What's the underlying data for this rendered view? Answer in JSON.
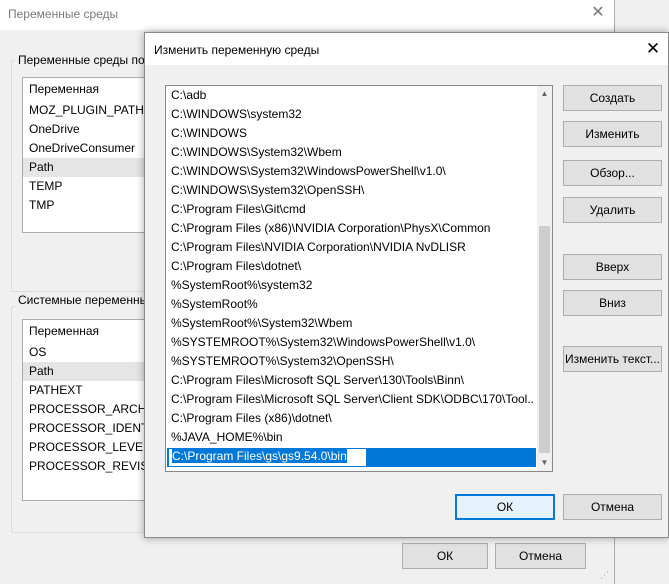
{
  "background_dialog": {
    "title": "Переменные среды",
    "user_group_label": "Переменные среды по",
    "user_list": {
      "header": "Переменная",
      "rows": [
        "MOZ_PLUGIN_PATH",
        "OneDrive",
        "OneDriveConsumer",
        "Path",
        "TEMP",
        "TMP"
      ]
    },
    "system_group_label": "Системные переменные",
    "system_list": {
      "header": "Переменная",
      "rows": [
        "OS",
        "Path",
        "PATHEXT",
        "PROCESSOR_ARCHITE",
        "PROCESSOR_IDENTIFI",
        "PROCESSOR_LEVEL",
        "PROCESSOR_REVISION"
      ]
    },
    "ok_label": "ОК",
    "cancel_label": "Отмена"
  },
  "edit_dialog": {
    "title": "Изменить переменную среды",
    "paths": [
      "C:\\adb",
      "C:\\WINDOWS\\system32",
      "C:\\WINDOWS",
      "C:\\WINDOWS\\System32\\Wbem",
      "C:\\WINDOWS\\System32\\WindowsPowerShell\\v1.0\\",
      "C:\\WINDOWS\\System32\\OpenSSH\\",
      "C:\\Program Files\\Git\\cmd",
      "C:\\Program Files (x86)\\NVIDIA Corporation\\PhysX\\Common",
      "C:\\Program Files\\NVIDIA Corporation\\NVIDIA NvDLISR",
      "C:\\Program Files\\dotnet\\",
      "%SystemRoot%\\system32",
      "%SystemRoot%",
      "%SystemRoot%\\System32\\Wbem",
      "%SYSTEMROOT%\\System32\\WindowsPowerShell\\v1.0\\",
      "%SYSTEMROOT%\\System32\\OpenSSH\\",
      "C:\\Program Files\\Microsoft SQL Server\\130\\Tools\\Binn\\",
      "C:\\Program Files\\Microsoft SQL Server\\Client SDK\\ODBC\\170\\Tool...",
      "C:\\Program Files (x86)\\dotnet\\",
      "%JAVA_HOME%\\bin"
    ],
    "editing_path": "C:\\Program Files\\gs\\gs9.54.0\\bin",
    "buttons": {
      "create": "Создать",
      "edit": "Изменить",
      "browse": "Обзор...",
      "delete": "Удалить",
      "up": "Вверх",
      "down": "Вниз",
      "edit_text": "Изменить текст..."
    },
    "ok_label": "ОК",
    "cancel_label": "Отмена"
  },
  "colors": {
    "accent": "#0078d7",
    "window_bg": "#f0f0f0",
    "button_bg": "#e1e1e1"
  }
}
